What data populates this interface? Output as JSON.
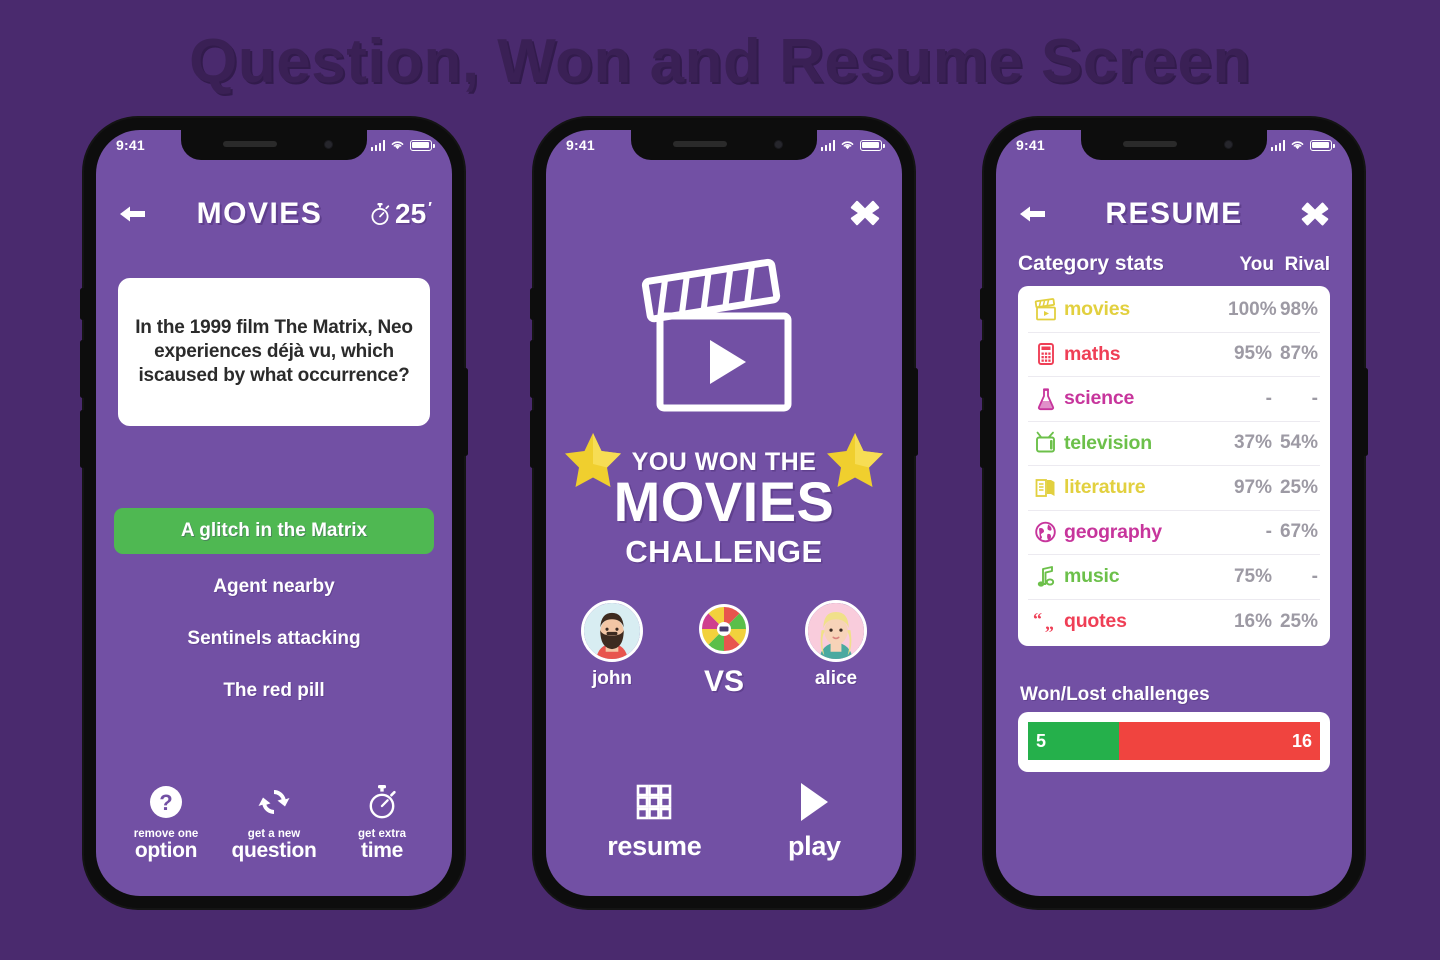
{
  "page": {
    "title": "Question, Won and Resume Screen",
    "background_color": "#4a2a6e",
    "screen_color": "#7250a4"
  },
  "status_bar": {
    "time": "9:41",
    "signal_icon": "signal-bars-icon",
    "wifi_icon": "wifi-icon",
    "battery_icon": "battery-icon"
  },
  "screen_question": {
    "header": {
      "back_icon": "back-arrow-icon",
      "title": "MOVIES",
      "timer_icon": "stopwatch-icon",
      "timer_value": "25",
      "timer_unit": "′"
    },
    "question": "In the 1999 film The Matrix, Neo experiences déjà vu, which iscaused by what occurrence?",
    "answers": [
      {
        "label": "A glitch in the Matrix",
        "state": "correct",
        "color": "#4fb852"
      },
      {
        "label": "Agent nearby",
        "state": "default"
      },
      {
        "label": "Sentinels attacking",
        "state": "default"
      },
      {
        "label": "The red pill",
        "state": "default"
      }
    ],
    "tools": [
      {
        "icon": "question-mark-circle-icon",
        "sub": "remove one",
        "main": "option"
      },
      {
        "icon": "refresh-cycle-icon",
        "sub": "get a new",
        "main": "question"
      },
      {
        "icon": "stopwatch-icon",
        "sub": "get extra",
        "main": "time"
      }
    ]
  },
  "screen_won": {
    "close_icon": "close-x-icon",
    "hero_icon": "clapperboard-play-icon",
    "star_icon": "star-icon",
    "line1": "YOU WON THE",
    "line2": "MOVIES",
    "line3": "CHALLENGE",
    "players": {
      "left": {
        "avatar": "avatar-male-icon",
        "name": "john"
      },
      "right": {
        "avatar": "avatar-female-icon",
        "name": "alice"
      },
      "vs_icon": "spin-wheel-icon",
      "vs_label": "VS"
    },
    "actions": [
      {
        "icon": "grid-squares-icon",
        "label": "resume"
      },
      {
        "icon": "play-triangle-icon",
        "label": "play"
      }
    ]
  },
  "screen_resume": {
    "header": {
      "back_icon": "back-arrow-icon",
      "title": "RESUME",
      "close_icon": "close-x-icon"
    },
    "stats": {
      "title": "Category stats",
      "col_you": "You",
      "col_rival": "Rival",
      "rows": [
        {
          "icon": "clapperboard-icon",
          "name": "movies",
          "color": "#e2d03f",
          "you": "100%",
          "rival": "98%"
        },
        {
          "icon": "calculator-icon",
          "name": "maths",
          "color": "#ef3f56",
          "you": "95%",
          "rival": "87%"
        },
        {
          "icon": "flask-icon",
          "name": "science",
          "color": "#c7359c",
          "you": "-",
          "rival": "-"
        },
        {
          "icon": "television-icon",
          "name": "television",
          "color": "#6cc04a",
          "you": "37%",
          "rival": "54%"
        },
        {
          "icon": "open-book-icon",
          "name": "literature",
          "color": "#e2d03f",
          "you": "97%",
          "rival": "25%"
        },
        {
          "icon": "globe-icon",
          "name": "geography",
          "color": "#c7359c",
          "you": "-",
          "rival": "67%"
        },
        {
          "icon": "music-note-icon",
          "name": "music",
          "color": "#6cc04a",
          "you": "75%",
          "rival": "-"
        },
        {
          "icon": "quote-marks-icon",
          "name": "quotes",
          "color": "#ef3f56",
          "you": "16%",
          "rival": "25%"
        }
      ]
    },
    "won_lost": {
      "title": "Won/Lost challenges",
      "won_count": "5",
      "lost_count": "16",
      "won_color": "#25b04b",
      "lost_color": "#f0443f",
      "won_percent": 31
    }
  }
}
